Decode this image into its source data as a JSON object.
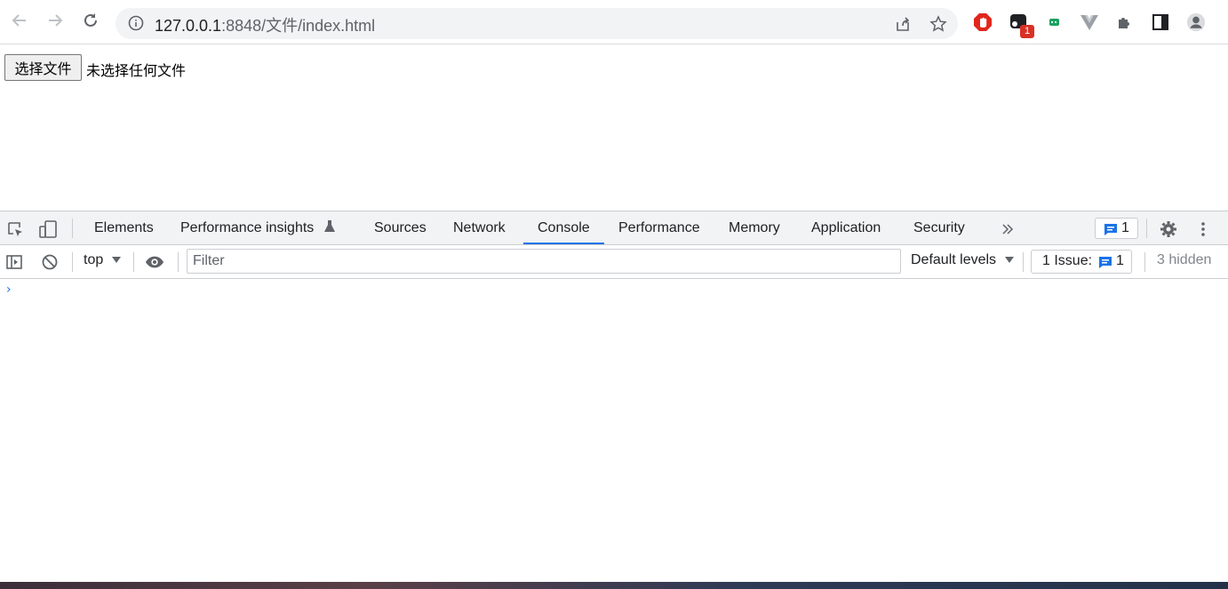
{
  "browser": {
    "url_host": "127.0.0.1",
    "url_port_path": ":8848/文件/index.html",
    "extension_badge": "1"
  },
  "page": {
    "file_button_label": "选择文件",
    "file_status": "未选择任何文件"
  },
  "devtools": {
    "tabs": [
      {
        "label": "Elements"
      },
      {
        "label": "Performance insights"
      },
      {
        "label": "Sources"
      },
      {
        "label": "Network"
      },
      {
        "label": "Console"
      },
      {
        "label": "Performance"
      },
      {
        "label": "Memory"
      },
      {
        "label": "Application"
      },
      {
        "label": "Security"
      }
    ],
    "active_tab": "Console",
    "issues_badge_count": "1",
    "console": {
      "context": "top",
      "filter_placeholder": "Filter",
      "levels_label": "Default levels",
      "issues_label": "1 Issue:",
      "issues_count": "1",
      "hidden_label": "3 hidden",
      "prompt": "›"
    }
  },
  "colors": {
    "accent": "#1a73e8",
    "badge": "#d93025",
    "toolbar_bg": "#f1f3f4"
  }
}
